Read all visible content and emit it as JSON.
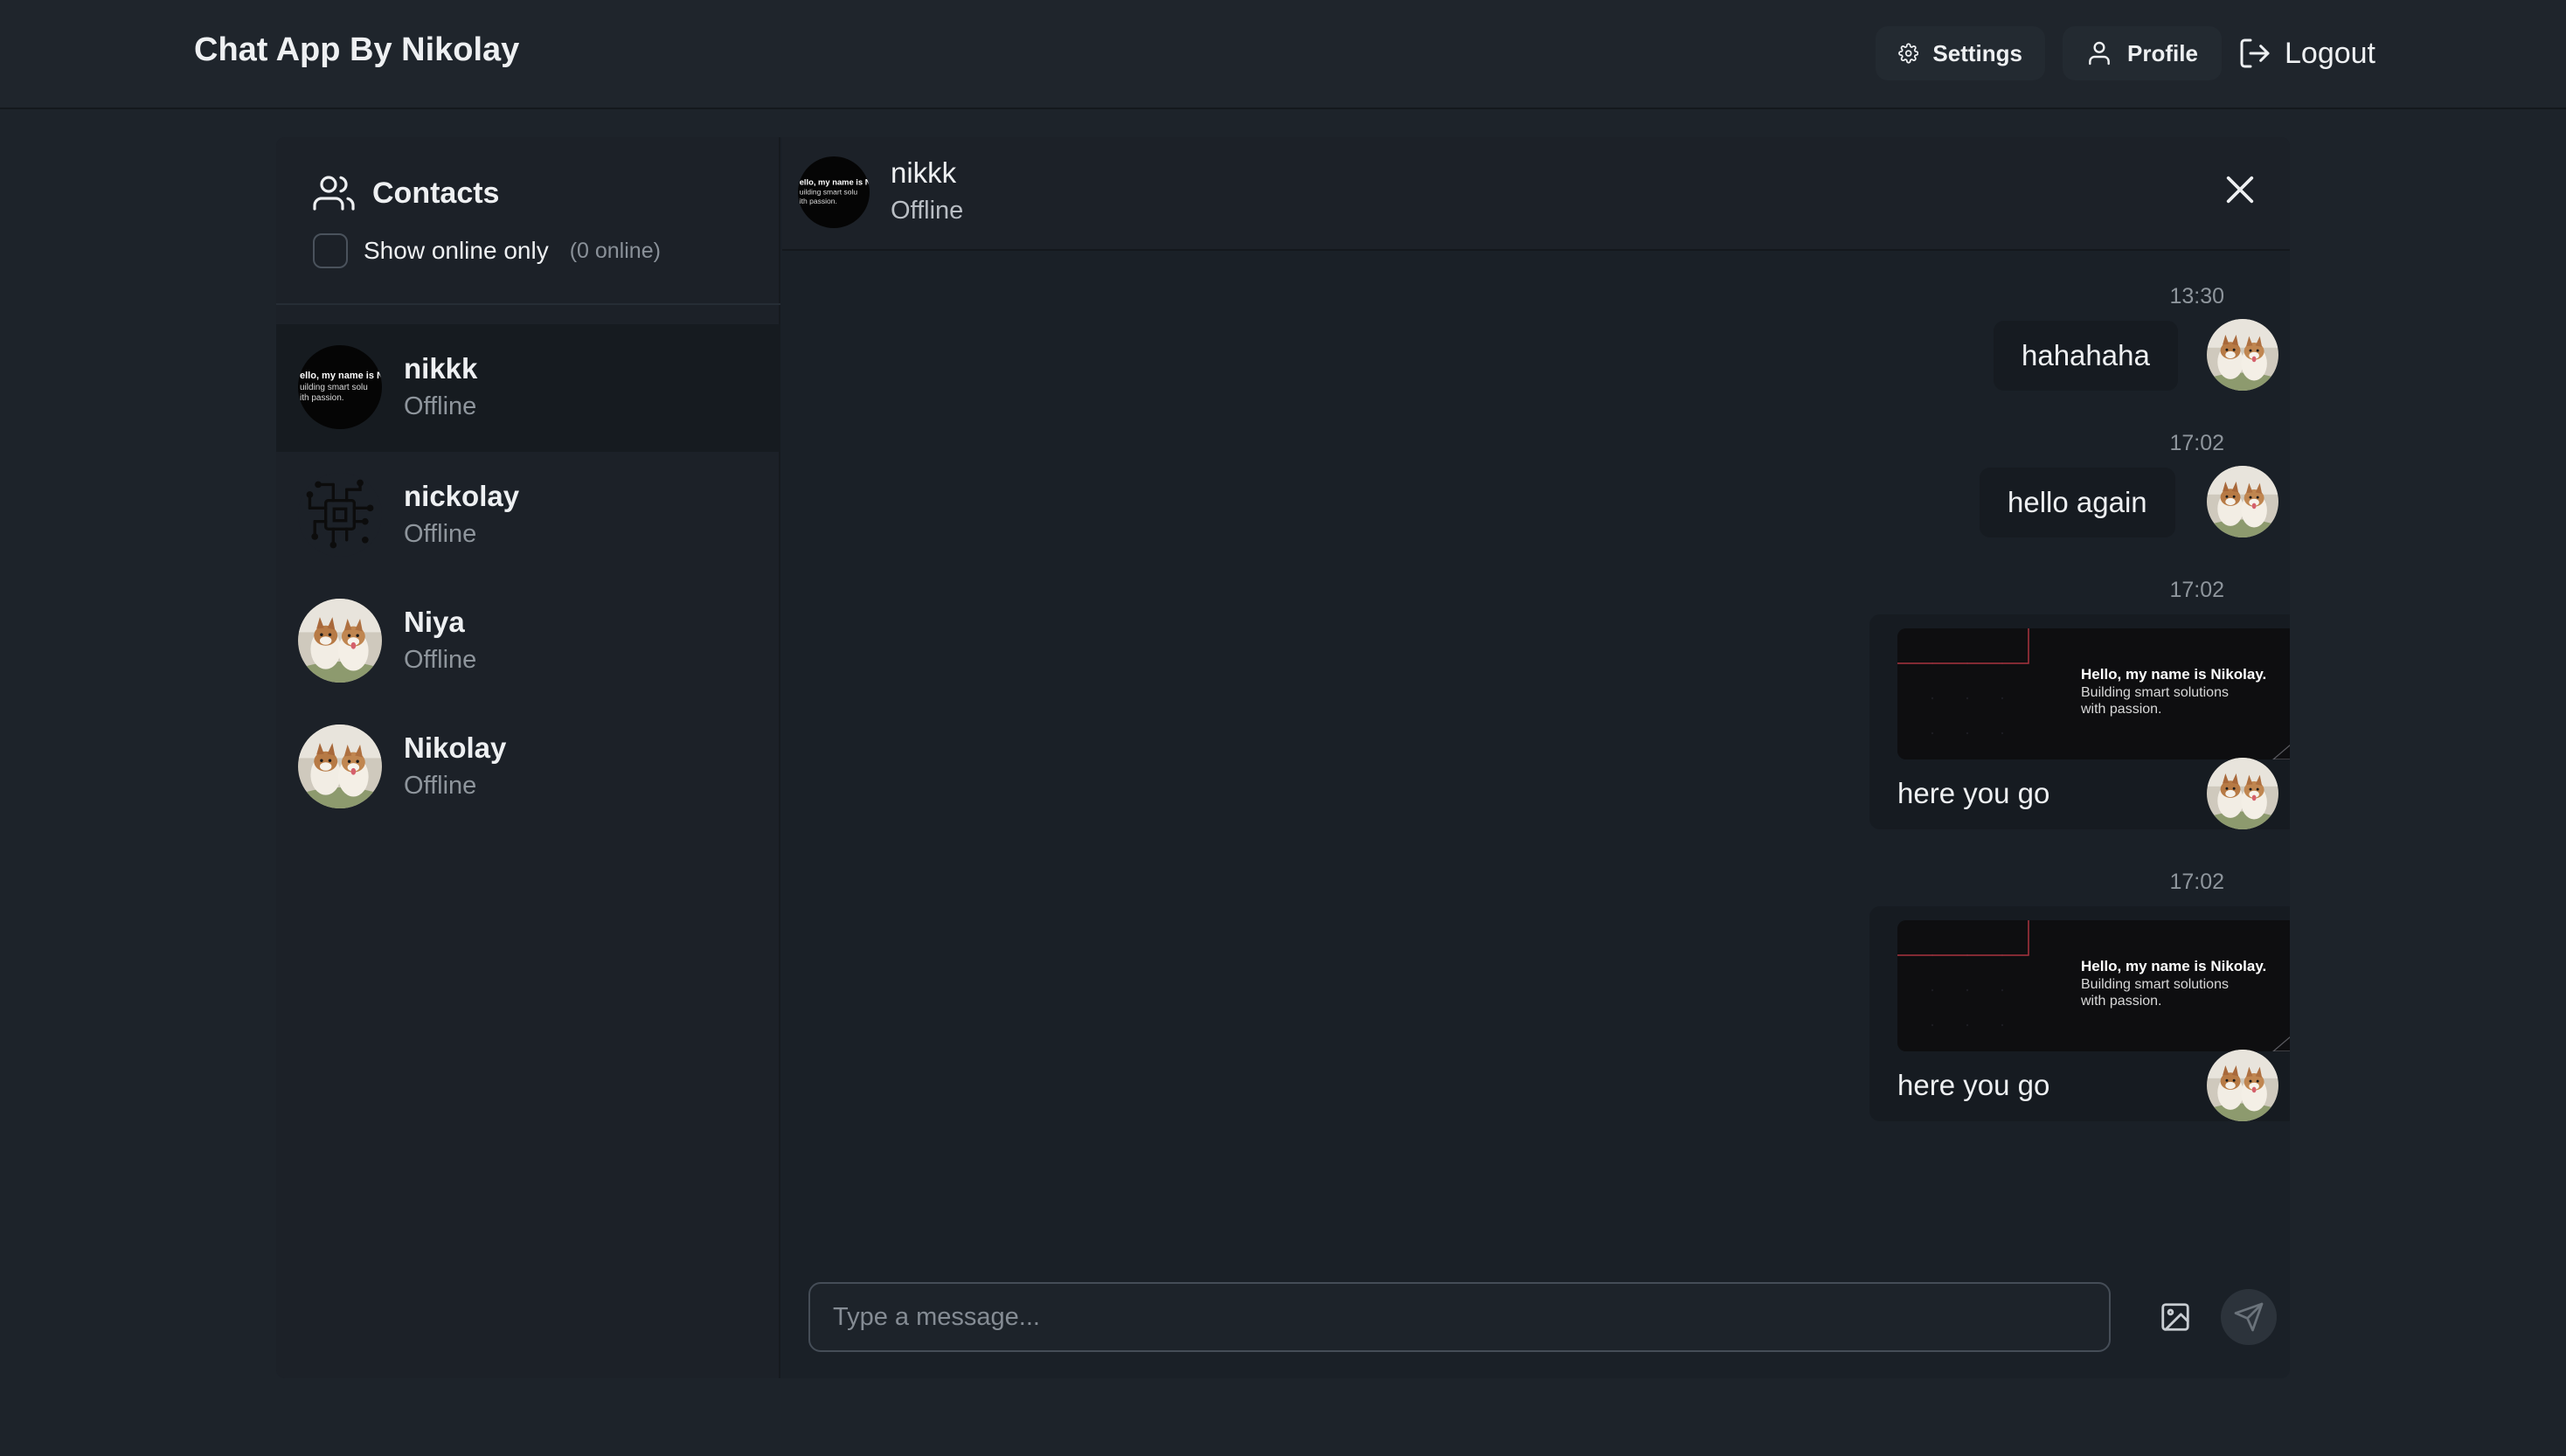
{
  "app": {
    "title": "Chat App By Nikolay"
  },
  "nav": {
    "settings_label": "Settings",
    "profile_label": "Profile",
    "logout_label": "Logout"
  },
  "sidebar": {
    "title": "Contacts",
    "filter_label": "Show online only",
    "online_count": "(0 online)",
    "contacts": [
      {
        "name": "nikkk",
        "status": "Offline",
        "avatar": "banner-avatar",
        "active": true
      },
      {
        "name": "nickolay",
        "status": "Offline",
        "avatar": "circuit-avatar",
        "active": false
      },
      {
        "name": "Niya",
        "status": "Offline",
        "avatar": "dogs-photo-avatar",
        "active": false
      },
      {
        "name": "Nikolay",
        "status": "Offline",
        "avatar": "dogs-photo-avatar",
        "active": false
      }
    ]
  },
  "chat": {
    "name": "nikkk",
    "status": "Offline",
    "messages": [
      {
        "time": "13:30",
        "text": "hahahaha",
        "has_image": false
      },
      {
        "time": "17:02",
        "text": "hello again",
        "has_image": false
      },
      {
        "time": "17:02",
        "text": "here you go",
        "has_image": true
      },
      {
        "time": "17:02",
        "text": "here you go",
        "has_image": true
      }
    ],
    "attachment": {
      "heading": "Hello, my name is Nikolay.",
      "line1": "Building smart solutions",
      "line2": "with passion."
    },
    "avatar_banner": {
      "line1": "ello, my name is N",
      "line2": "uilding smart solu",
      "line3": "ith passion."
    }
  },
  "composer": {
    "placeholder": "Type a message..."
  },
  "colors": {
    "background": "#1d232a",
    "panel": "#1c2128",
    "bubble": "#161b21",
    "text": "#eef0f2",
    "muted": "#8e959c",
    "banner_accent": "#a8333f"
  }
}
